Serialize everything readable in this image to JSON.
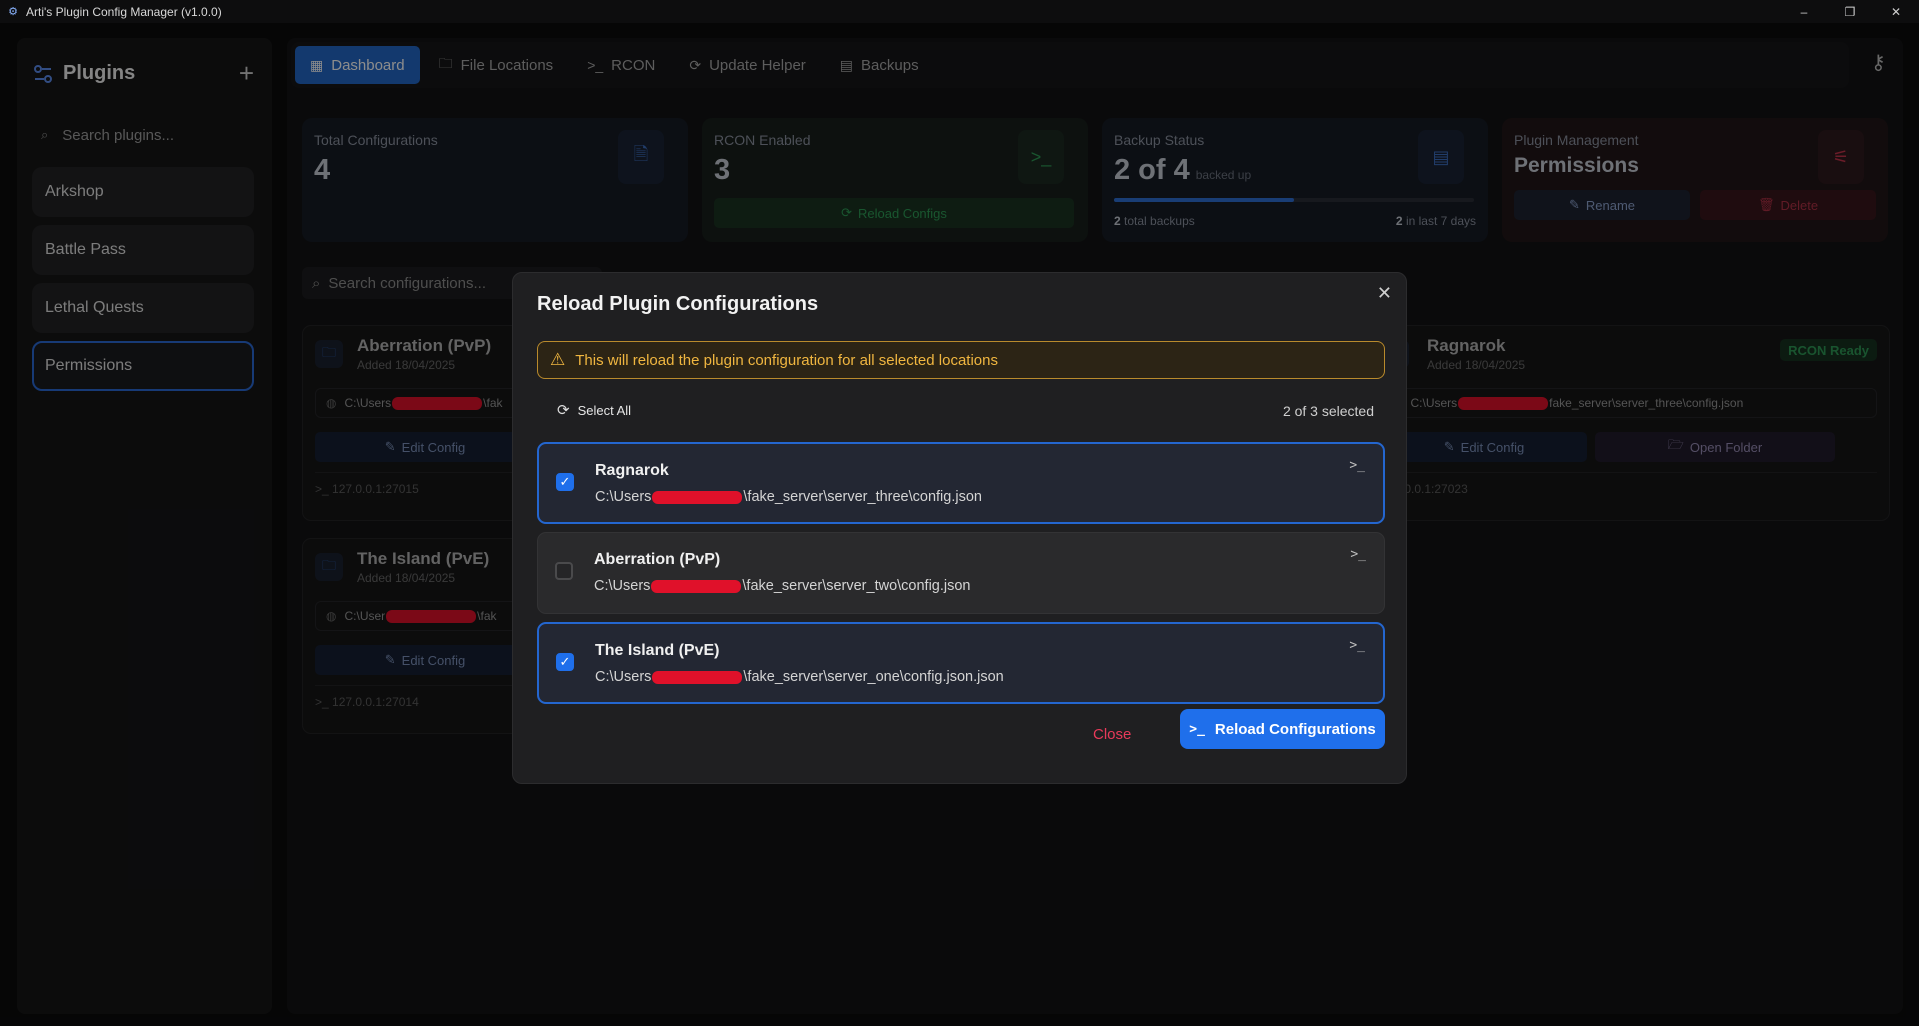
{
  "window": {
    "title": "Arti's Plugin Config Manager (v1.0.0)",
    "controls": [
      "–",
      "❐",
      "✕"
    ]
  },
  "sidebar": {
    "title": "Plugins",
    "add_icon": "plus-icon",
    "search_placeholder": "Search plugins...",
    "items": [
      {
        "label": "Arkshop",
        "active": false
      },
      {
        "label": "Battle Pass",
        "active": false
      },
      {
        "label": "Lethal Quests",
        "active": false
      },
      {
        "label": "Permissions",
        "active": true
      }
    ]
  },
  "nav": {
    "tabs": [
      {
        "label": "Dashboard",
        "icon": "dashboard-icon",
        "active": true
      },
      {
        "label": "File Locations",
        "icon": "folder-icon",
        "active": false
      },
      {
        "label": "RCON",
        "icon": "terminal-icon",
        "active": false
      },
      {
        "label": "Update Helper",
        "icon": "refresh-icon",
        "active": false
      },
      {
        "label": "Backups",
        "icon": "archive-icon",
        "active": false
      }
    ]
  },
  "stats": {
    "total": {
      "label": "Total Configurations",
      "value": "4"
    },
    "rcon": {
      "label": "RCON Enabled",
      "value": "3",
      "button": "Reload Configs"
    },
    "backup": {
      "label": "Backup Status",
      "value": "2 of 4",
      "suffix": "backed up",
      "progress": 0.5,
      "total_count": "2",
      "total_text": "total backups",
      "recent_count": "2",
      "recent_text": "in last 7 days"
    },
    "plugin_mgmt": {
      "label": "Plugin Management",
      "name": "Permissions",
      "rename": "Rename",
      "delete": "Delete"
    }
  },
  "filters": {
    "search_placeholder": "Search configurations..."
  },
  "configs": [
    {
      "name": "Aberration (PvP)",
      "added": "Added 18/04/2025",
      "path_prefix": "C:\\Users",
      "path_suffix": "\\fak",
      "edit": "Edit Config",
      "rcon": ">_ 127.0.0.1:27015"
    },
    {
      "name": "The Island (PvE)",
      "added": "Added 18/04/2025",
      "path_prefix": "C:\\User",
      "path_suffix": "\\fak",
      "edit": "Edit Config",
      "rcon": ">_ 127.0.0.1:27014"
    },
    {
      "name": "Ragnarok",
      "added": "Added 18/04/2025",
      "path_prefix": "C:\\Users",
      "path_suffix": "fake_server\\server_three\\config.json",
      "edit": "Edit Config",
      "open": "Open Folder",
      "badge": "RCON Ready",
      "rcon": "127.0.0.1:27023"
    }
  ],
  "modal": {
    "title": "Reload Plugin Configurations",
    "warning": "This will reload the plugin configuration for all selected locations",
    "select_all": "Select All",
    "selected_count": "2 of 3 selected",
    "locations": [
      {
        "name": "Ragnarok",
        "path_prefix": "C:\\Users",
        "path_suffix": "\\fake_server\\server_three\\config.json",
        "checked": true
      },
      {
        "name": "Aberration (PvP)",
        "path_prefix": "C:\\Users",
        "path_suffix": "\\fake_server\\server_two\\config.json",
        "checked": false
      },
      {
        "name": "The Island (PvE)",
        "path_prefix": "C:\\Users",
        "path_suffix": "\\fake_server\\server_one\\config.json.json",
        "checked": true
      }
    ],
    "close": "Close",
    "reload": "Reload Configurations"
  },
  "colors": {
    "accent": "#1f6feb",
    "danger": "#e83a5a",
    "warning": "#f0b640",
    "success": "#2e9d57"
  }
}
